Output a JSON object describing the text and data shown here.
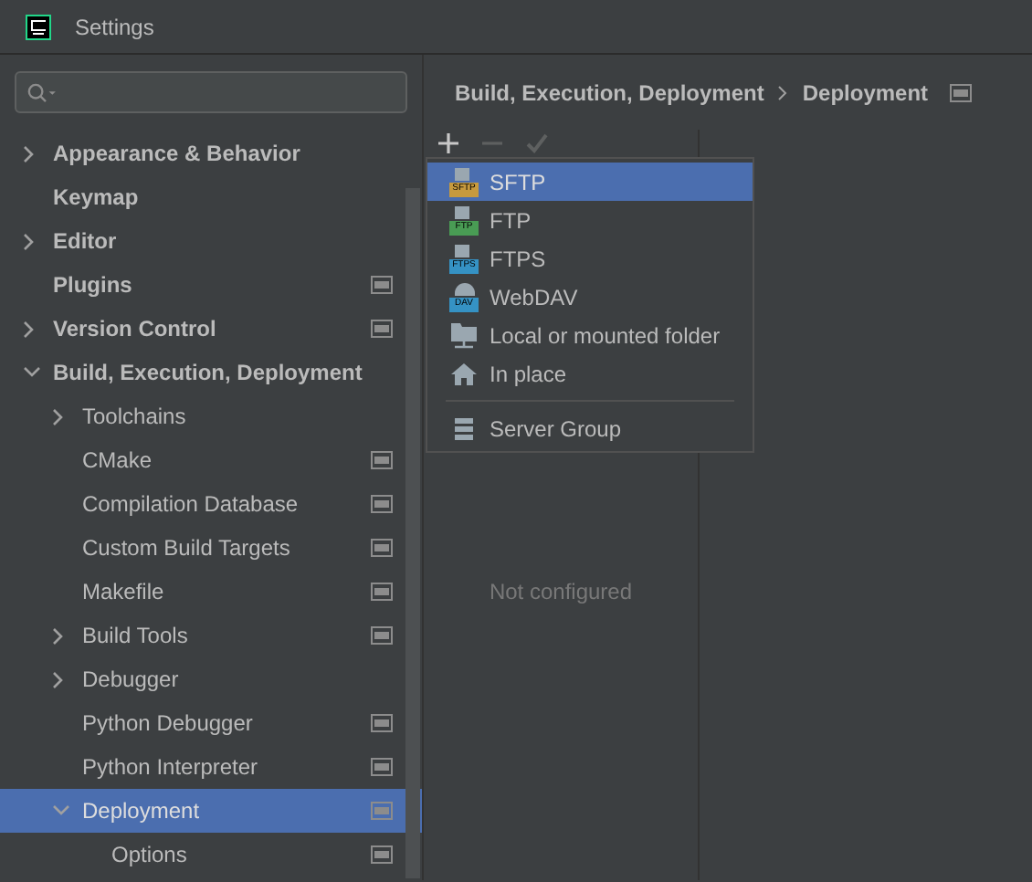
{
  "window": {
    "title": "Settings"
  },
  "tree": [
    {
      "label": "Appearance & Behavior",
      "expanded": false,
      "selected": false,
      "project_icon": false
    },
    {
      "label": "Keymap",
      "selected": false,
      "project_icon": false
    },
    {
      "label": "Editor",
      "expanded": false,
      "selected": false,
      "project_icon": false
    },
    {
      "label": "Plugins",
      "selected": false,
      "project_icon": true
    },
    {
      "label": "Version Control",
      "expanded": false,
      "selected": false,
      "project_icon": true
    },
    {
      "label": "Build, Execution, Deployment",
      "expanded": true,
      "selected": false,
      "project_icon": false,
      "children": [
        {
          "label": "Toolchains",
          "expanded": false,
          "selected": false,
          "project_icon": false
        },
        {
          "label": "CMake",
          "selected": false,
          "project_icon": true
        },
        {
          "label": "Compilation Database",
          "selected": false,
          "project_icon": true
        },
        {
          "label": "Custom Build Targets",
          "selected": false,
          "project_icon": true
        },
        {
          "label": "Makefile",
          "selected": false,
          "project_icon": true
        },
        {
          "label": "Build Tools",
          "expanded": false,
          "selected": false,
          "project_icon": true
        },
        {
          "label": "Debugger",
          "expanded": false,
          "selected": false,
          "project_icon": false
        },
        {
          "label": "Python Debugger",
          "selected": false,
          "project_icon": true
        },
        {
          "label": "Python Interpreter",
          "selected": false,
          "project_icon": true
        },
        {
          "label": "Deployment",
          "expanded": true,
          "selected": true,
          "project_icon": true,
          "children": [
            {
              "label": "Options",
              "selected": false,
              "project_icon": true
            }
          ]
        }
      ]
    }
  ],
  "breadcrumb": [
    "Build, Execution, Deployment",
    "Deployment"
  ],
  "server_list": {
    "empty_text": "Not configured"
  },
  "add_menu": [
    {
      "kind": "server",
      "label": "SFTP",
      "badge": "SFTP",
      "color": "#c79a3e",
      "selected": true
    },
    {
      "kind": "server",
      "label": "FTP",
      "badge": "FTP",
      "color": "#499c54",
      "selected": false
    },
    {
      "kind": "server",
      "label": "FTPS",
      "badge": "FTPS",
      "color": "#3592c4",
      "selected": false
    },
    {
      "kind": "cloud",
      "label": "WebDAV",
      "badge": "DAV",
      "color": "#3592c4",
      "selected": false
    },
    {
      "kind": "folder",
      "label": "Local or mounted folder",
      "selected": false
    },
    {
      "kind": "home",
      "label": "In place",
      "selected": false
    },
    {
      "kind": "separator"
    },
    {
      "kind": "group",
      "label": "Server Group",
      "selected": false
    }
  ]
}
